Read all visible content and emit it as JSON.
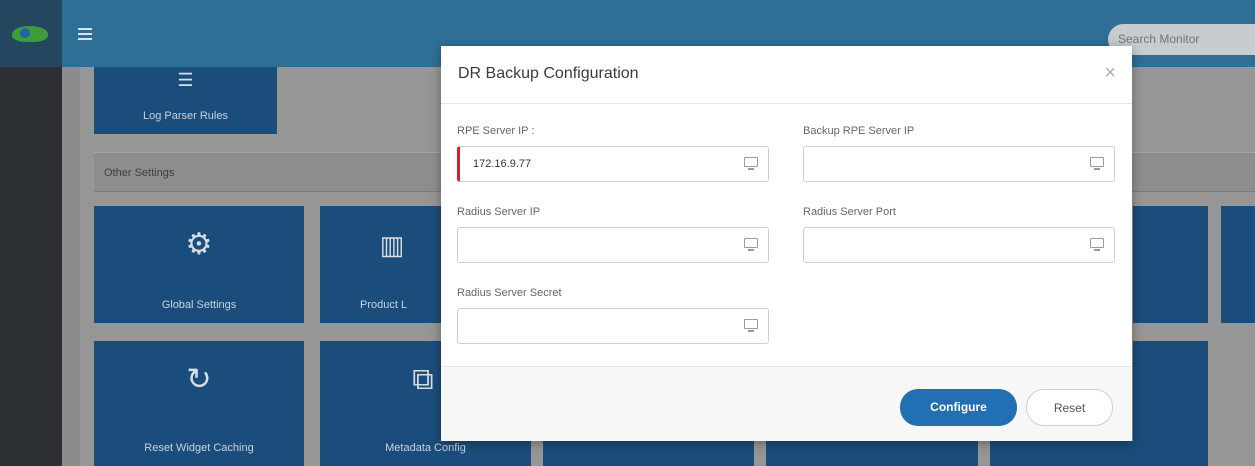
{
  "header": {
    "search_placeholder": "Search Monitor"
  },
  "tiles": {
    "log_parser_rules": "Log Parser Rules",
    "global_settings": "Global Settings",
    "product_partial": "Product L",
    "reset_widget_caching": "Reset Widget Caching",
    "metadata_config_partial": "Metadata Config"
  },
  "section": {
    "other_settings": "Other Settings"
  },
  "modal": {
    "title": "DR Backup Configuration",
    "close_icon": "close-icon",
    "fields": {
      "rpe_server_ip": {
        "label": "RPE Server IP :",
        "value": "172.16.9.77",
        "state": "invalid"
      },
      "backup_rpe_server_ip": {
        "label": "Backup RPE Server IP",
        "value": ""
      },
      "radius_server_ip": {
        "label": "Radius Server IP",
        "value": ""
      },
      "radius_server_port": {
        "label": "Radius Server Port",
        "value": ""
      },
      "radius_server_secret": {
        "label": "Radius Server Secret",
        "value": ""
      }
    },
    "buttons": {
      "configure": "Configure",
      "reset": "Reset"
    }
  },
  "colors": {
    "header_blue": "#2f6f96",
    "tile_blue": "#1a4d7b",
    "primary_button": "#236fb3",
    "invalid_border": "#d91c2a"
  },
  "icons": {
    "field_icon": "monitor-icon",
    "global_settings_icon": "gears-icon",
    "product_icon": "barcode-icon",
    "reset_icon": "refresh-icon",
    "metadata_icon": "copy-icon",
    "log_parser_icon": "database-icon"
  }
}
